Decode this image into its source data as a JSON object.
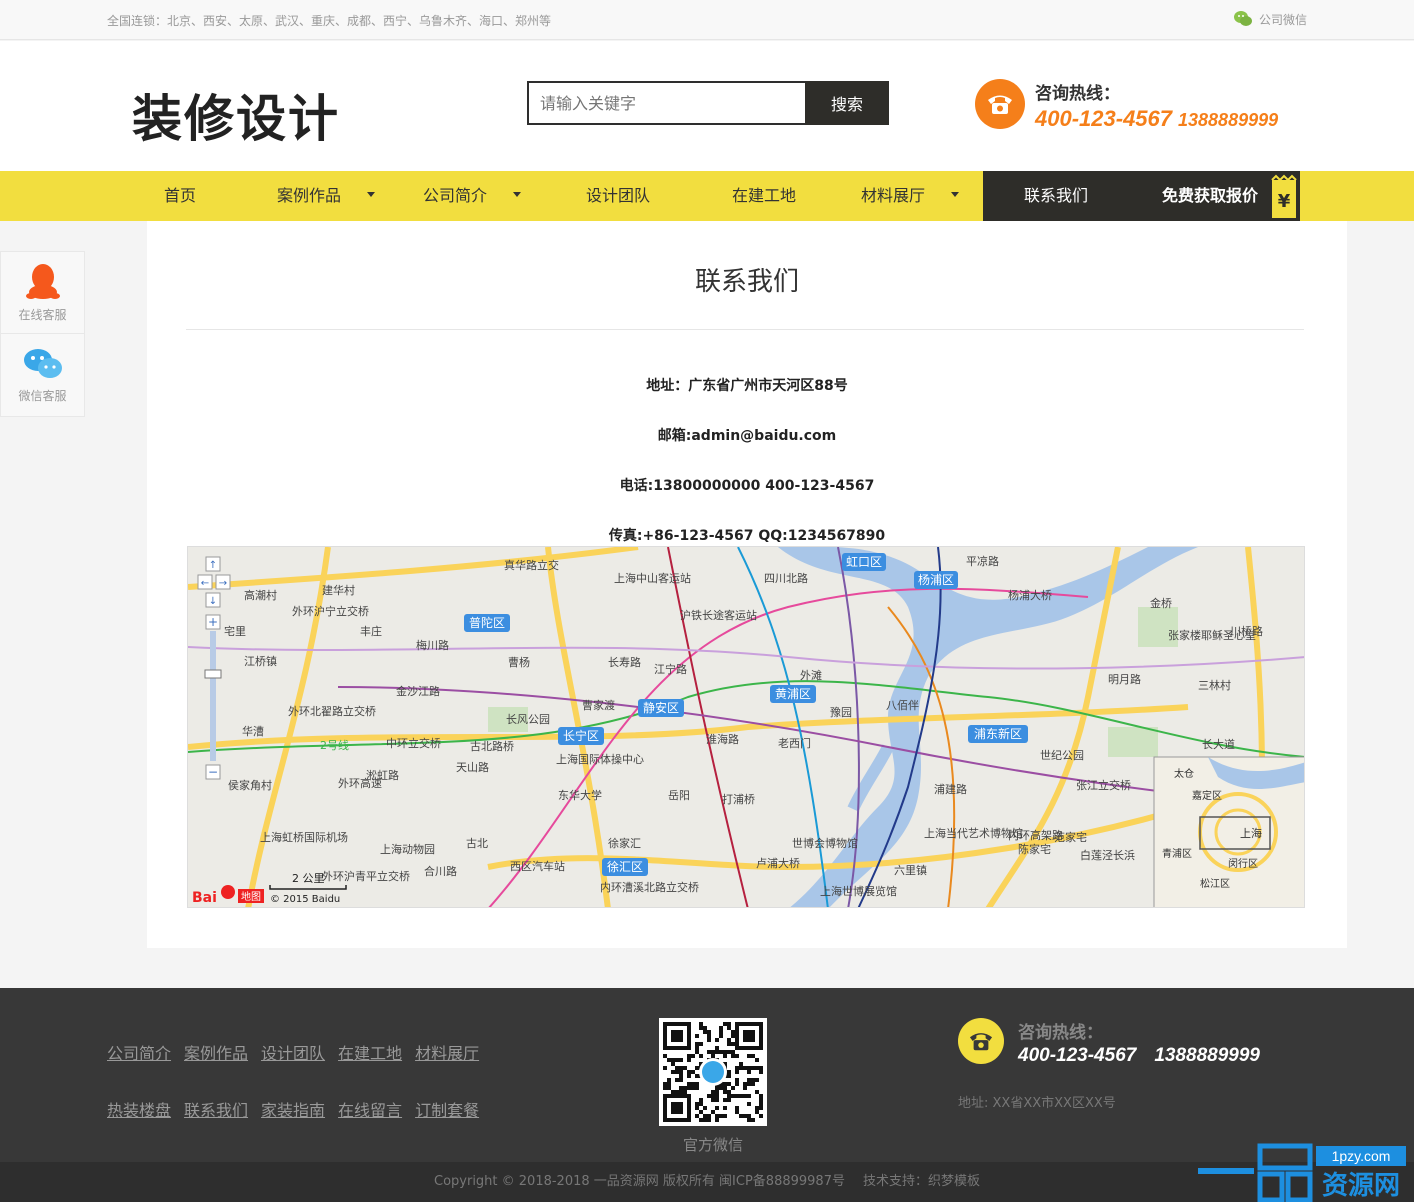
{
  "topbar": {
    "cities": "全国连锁：北京、西安、太原、武汉、重庆、成都、西宁、乌鲁木齐、海口、郑州等",
    "wechat": "公司微信"
  },
  "header": {
    "logo": "装修设计",
    "search_placeholder": "请输入关键字",
    "search_button": "搜索",
    "hotline_label": "咨询热线：",
    "hotline_1": "400-123-4567",
    "hotline_2": "1388889999"
  },
  "nav": {
    "items": [
      {
        "label": "首页"
      },
      {
        "label": "案例作品"
      },
      {
        "label": "公司简介"
      },
      {
        "label": "设计团队"
      },
      {
        "label": "在建工地"
      },
      {
        "label": "材料展厅"
      },
      {
        "label": "联系我们"
      }
    ],
    "quote": "免费获取报价"
  },
  "side": {
    "online": "在线客服",
    "wechat": "微信客服"
  },
  "content": {
    "title": "联系我们",
    "address": "地址：广东省广州市天河区88号",
    "email": "邮箱:admin@baidu.com",
    "phone": "电话:13800000000 400-123-4567",
    "fax": "传真:+86-123-4567  QQ:1234567890"
  },
  "map": {
    "labels": [
      "真华路立交",
      "上海中山客运站",
      "四川北路",
      "虹口区",
      "杨浦区",
      "平凉路",
      "杨浦大桥",
      "高潮村",
      "建华村",
      "外环沪宁立交桥",
      "丰庄",
      "普陀区",
      "沪铁长途客运站",
      "金桥",
      "张家楼耶稣圣心堂",
      "川桥路",
      "宅里",
      "江桥镇",
      "梅川路",
      "曹杨",
      "长寿路",
      "江宁路",
      "外滩",
      "明月路",
      "金沙江路",
      "曹家渡",
      "黄浦区",
      "豫园",
      "八佰伴",
      "三林村",
      "外环北翟路立交桥",
      "长风公园",
      "静安区",
      "华漕",
      "2号线",
      "中环立交桥",
      "古北路桥",
      "长宁区",
      "淮海路",
      "老西门",
      "浦东新区",
      "世纪公园",
      "侯家角村",
      "天山路",
      "上海国际体操中心",
      "东华大学",
      "岳阳",
      "打浦桥",
      "浦建路",
      "张江立交桥",
      "外环高速",
      "淞虹路",
      "上海当代艺术博物馆",
      "内环高架路",
      "陈家宅",
      "范家宅",
      "上海虹桥国际机场",
      "上海动物园",
      "古北",
      "徐家汇",
      "世博会博物馆",
      "白莲泾长浜",
      "西区汽车站",
      "徐汇区",
      "卢浦大桥",
      "六里镇",
      "外环沪青平立交桥",
      "合川路",
      "内环漕溪北路立交桥",
      "上海世博展览馆",
      "太仓",
      "嘉定区",
      "青浦区",
      "上海",
      "闵行区",
      "松江区",
      "长大道"
    ],
    "scale": "2 公里",
    "copyright": "© 2015 Baidu",
    "brand": "Bai",
    "brand2": "地图"
  },
  "footer": {
    "links_row1": [
      "公司简介",
      "案例作品",
      "设计团队",
      "在建工地",
      "材料展厅"
    ],
    "links_row2": [
      "热装楼盘",
      "联系我们",
      "家装指南",
      "在线留言",
      "订制套餐"
    ],
    "qr_label": "官方微信",
    "hotline_label": "咨询热线：",
    "hotline_1": "400-123-4567",
    "hotline_2": "1388889999",
    "address": "地址: XX省XX市XX区XX号",
    "copyright": "Copyright © 2018-2018 一品资源网 版权所有 闽ICP备88899987号",
    "support": "技术支持：织梦模板",
    "watermark_url": "1pzy.com",
    "watermark_name": "资源网"
  },
  "colors": {
    "accent": "#f2de3f",
    "orange": "#f57f1a",
    "dark": "#2e2d29"
  }
}
